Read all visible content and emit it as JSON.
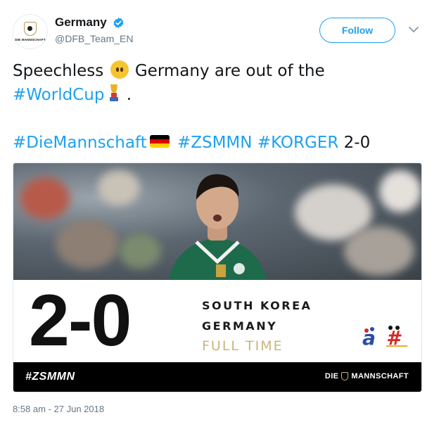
{
  "account": {
    "display_name": "Germany",
    "handle": "@DFB_Team_EN",
    "avatar_caption": "DIE MANNSCHAFT",
    "verified": true
  },
  "actions": {
    "follow_label": "Follow",
    "more_icon": "chevron-down-icon"
  },
  "tweet": {
    "line1_text": "Speechless",
    "line1_emoji": "neutral-face-icon",
    "line1_tail": "Germany are out of the",
    "line2_tag": "#WorldCup",
    "line2_emoji": "world-cup-trophy-icon",
    "line2_tail": ".",
    "line3_tag1": "#DieMannschaft",
    "line3_emoji": "germany-flag-icon",
    "line3_tag2": "#ZSMMN",
    "line3_tag3": "#KORGER",
    "line3_tail": "2-0"
  },
  "media": {
    "score": "2-0",
    "team1": "SOUTH KOREA",
    "team2": "GERMANY",
    "status": "FULL TIME",
    "footer_tag": "#ZSMMN",
    "footer_brand_left": "DIE",
    "footer_brand_right": "MANNSCHAFT"
  },
  "meta": {
    "timestamp": "8:58 am - 27 Jun 2018"
  },
  "colors": {
    "link": "#1da1f2",
    "text": "#14171a",
    "muted": "#657786",
    "gold": "#c9b47a",
    "flag": [
      "#000000",
      "#dd0000",
      "#ffce00"
    ]
  }
}
